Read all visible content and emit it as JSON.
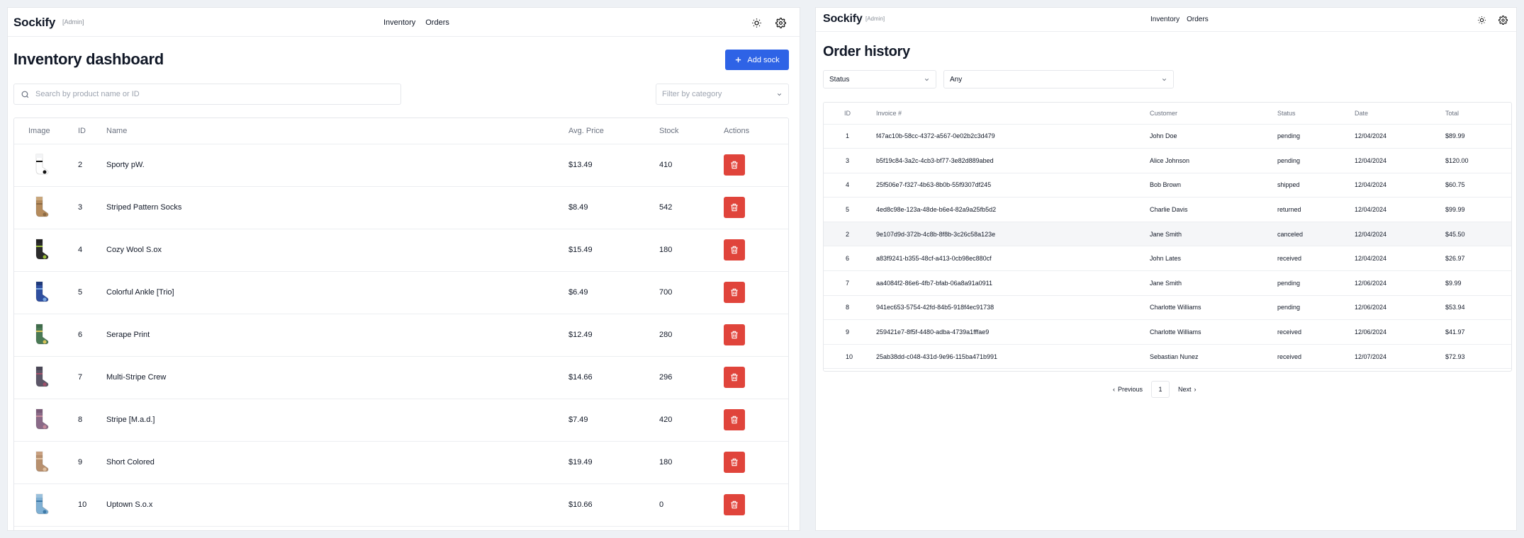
{
  "inventory": {
    "brand": "Sockify",
    "brand_tag": "[Admin]",
    "nav": [
      "Inventory",
      "Orders"
    ],
    "title": "Inventory dashboard",
    "add_button": "Add sock",
    "search_placeholder": "Search by product name or ID",
    "filter_placeholder": "Filter by category",
    "columns": [
      "Image",
      "ID",
      "Name",
      "Avg. Price",
      "Stock",
      "Actions"
    ],
    "rows": [
      {
        "id": "2",
        "name": "Sporty pW.",
        "price": "$13.49",
        "stock": "410",
        "sock": {
          "top": "#f3f4f6",
          "body": "#ffffff",
          "accent": "#111111"
        }
      },
      {
        "id": "3",
        "name": "Striped Pattern Socks",
        "price": "$8.49",
        "stock": "542",
        "sock": {
          "top": "#c9a77c",
          "body": "#b58b5c",
          "accent": "#8c6a44"
        }
      },
      {
        "id": "4",
        "name": "Cozy Wool S.ox",
        "price": "$15.49",
        "stock": "180",
        "sock": {
          "top": "#222222",
          "body": "#2b2b2b",
          "accent": "#9bbf3a"
        }
      },
      {
        "id": "5",
        "name": "Colorful Ankle [Trio]",
        "price": "$6.49",
        "stock": "700",
        "sock": {
          "top": "#1f3a7a",
          "body": "#2f4fa0",
          "accent": "#79a8e0"
        }
      },
      {
        "id": "6",
        "name": "Serape Print",
        "price": "$12.49",
        "stock": "280",
        "sock": {
          "top": "#3f6b4a",
          "body": "#4a7a55",
          "accent": "#d8c35a"
        }
      },
      {
        "id": "7",
        "name": "Multi-Stripe Crew",
        "price": "$14.66",
        "stock": "296",
        "sock": {
          "top": "#4a4656",
          "body": "#5c5668",
          "accent": "#a0506a"
        }
      },
      {
        "id": "8",
        "name": "Stripe [M.a.d.]",
        "price": "$7.49",
        "stock": "420",
        "sock": {
          "top": "#7a5a78",
          "body": "#8a6a88",
          "accent": "#c48a9a"
        }
      },
      {
        "id": "9",
        "name": "Short Colored",
        "price": "$19.49",
        "stock": "180",
        "sock": {
          "top": "#c8a080",
          "body": "#b8906e",
          "accent": "#e0c0a0"
        }
      },
      {
        "id": "10",
        "name": "Uptown S.o.x",
        "price": "$10.66",
        "stock": "0",
        "sock": {
          "top": "#9ac0dc",
          "body": "#7fb0d4",
          "accent": "#3e7aa8"
        }
      }
    ]
  },
  "orders": {
    "brand": "Sockify",
    "brand_tag": "[Admin]",
    "nav": [
      "Inventory",
      "Orders"
    ],
    "title": "Order history",
    "status_filter": "Status",
    "any_filter": "Any",
    "columns": [
      "ID",
      "Invoice #",
      "Customer",
      "Status",
      "Date",
      "Total"
    ],
    "rows": [
      {
        "id": "1",
        "invoice": "f47ac10b-58cc-4372-a567-0e02b2c3d479",
        "customer": "John Doe",
        "status": "pending",
        "date": "12/04/2024",
        "total": "$89.99"
      },
      {
        "id": "3",
        "invoice": "b5f19c84-3a2c-4cb3-bf77-3e82d889abed",
        "customer": "Alice Johnson",
        "status": "pending",
        "date": "12/04/2024",
        "total": "$120.00"
      },
      {
        "id": "4",
        "invoice": "25f506e7-f327-4b63-8b0b-55f9307df245",
        "customer": "Bob Brown",
        "status": "shipped",
        "date": "12/04/2024",
        "total": "$60.75"
      },
      {
        "id": "5",
        "invoice": "4ed8c98e-123a-48de-b6e4-82a9a25fb5d2",
        "customer": "Charlie Davis",
        "status": "returned",
        "date": "12/04/2024",
        "total": "$99.99"
      },
      {
        "id": "2",
        "invoice": "9e107d9d-372b-4c8b-8f8b-3c26c58a123e",
        "customer": "Jane Smith",
        "status": "canceled",
        "date": "12/04/2024",
        "total": "$45.50"
      },
      {
        "id": "6",
        "invoice": "a83f9241-b355-48cf-a413-0cb98ec880cf",
        "customer": "John Lates",
        "status": "received",
        "date": "12/04/2024",
        "total": "$26.97"
      },
      {
        "id": "7",
        "invoice": "aa4084f2-86e6-4fb7-bfab-06a8a91a0911",
        "customer": "Jane Smith",
        "status": "pending",
        "date": "12/06/2024",
        "total": "$9.99"
      },
      {
        "id": "8",
        "invoice": "941ec653-5754-42fd-84b5-918f4ec91738",
        "customer": "Charlotte Williams",
        "status": "pending",
        "date": "12/06/2024",
        "total": "$53.94"
      },
      {
        "id": "9",
        "invoice": "259421e7-8f5f-4480-adba-4739a1fffae9",
        "customer": "Charlotte Williams",
        "status": "received",
        "date": "12/06/2024",
        "total": "$41.97"
      },
      {
        "id": "10",
        "invoice": "25ab38dd-c048-431d-9e96-115ba471b991",
        "customer": "Sebastian Nunez",
        "status": "received",
        "date": "12/07/2024",
        "total": "$72.93"
      }
    ],
    "pagination": {
      "previous": "Previous",
      "page": "1",
      "next": "Next"
    }
  },
  "icons": {
    "theme": "sun-icon",
    "settings": "gear-icon",
    "search": "search-icon",
    "add": "plus-icon",
    "delete": "trash-icon",
    "chevron": "chevron-down-icon"
  },
  "colors": {
    "primary": "#2e63e6",
    "danger": "#e0443b",
    "highlight_row": "#f5f6f8"
  }
}
